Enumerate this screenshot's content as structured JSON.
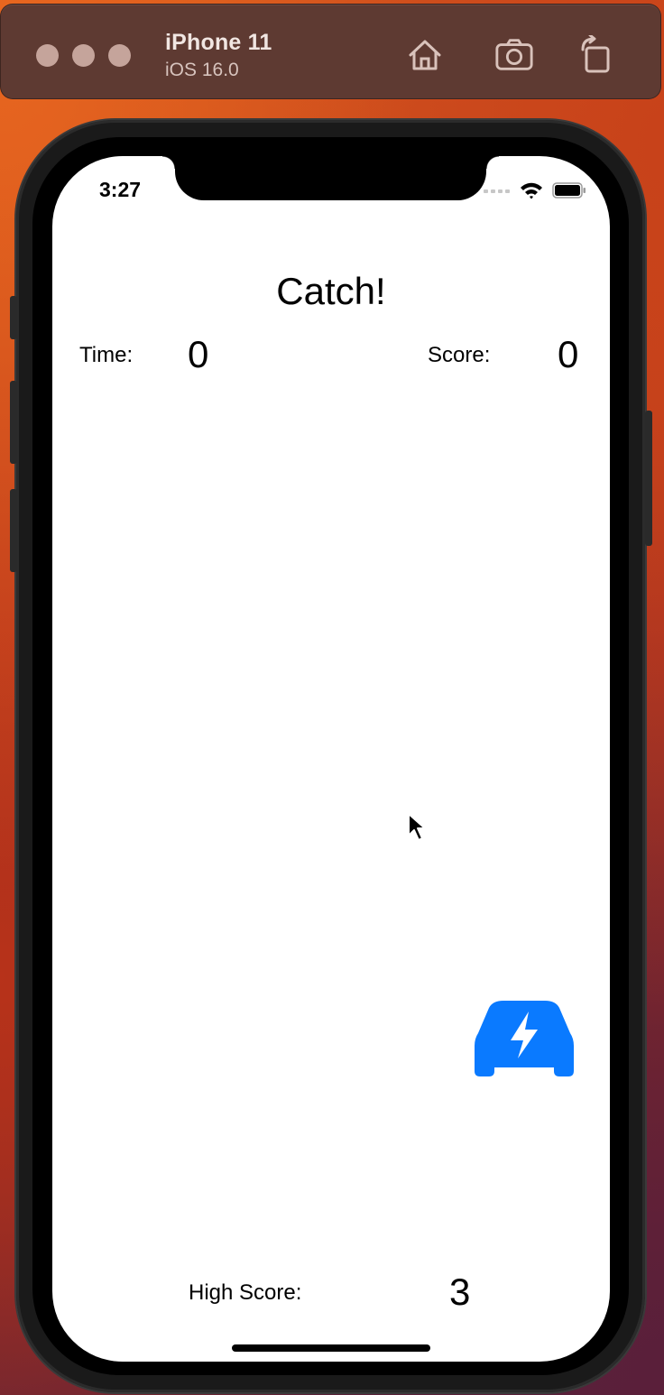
{
  "simulator": {
    "device_name": "iPhone 11",
    "os_version": "iOS 16.0",
    "toolbar_icons": [
      "home-icon",
      "screenshot-icon",
      "rotate-icon"
    ]
  },
  "status_bar": {
    "time": "3:27",
    "icons": [
      "cellular-signal-icon",
      "wifi-icon",
      "battery-icon"
    ]
  },
  "game": {
    "title": "Catch!",
    "time_label": "Time:",
    "time_value": "0",
    "score_label": "Score:",
    "score_value": "0",
    "high_score_label": "High Score:",
    "high_score_value": "3",
    "target_icon": "electric-car-icon",
    "target_color": "#0a7aff"
  }
}
